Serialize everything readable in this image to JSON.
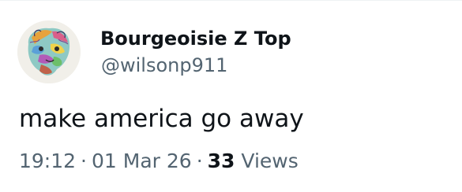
{
  "author": {
    "display_name": "Bourgeoisie Z Top",
    "handle": "@wilsonp911"
  },
  "tweet": {
    "text": "make america go away"
  },
  "meta": {
    "time": "19:12",
    "separator": "·",
    "date": "01 Mar 26",
    "views_count": "33",
    "views_label": "Views"
  },
  "colors": {
    "primary_text": "#0f1419",
    "secondary_text": "#536471",
    "background": "#ffffff"
  }
}
